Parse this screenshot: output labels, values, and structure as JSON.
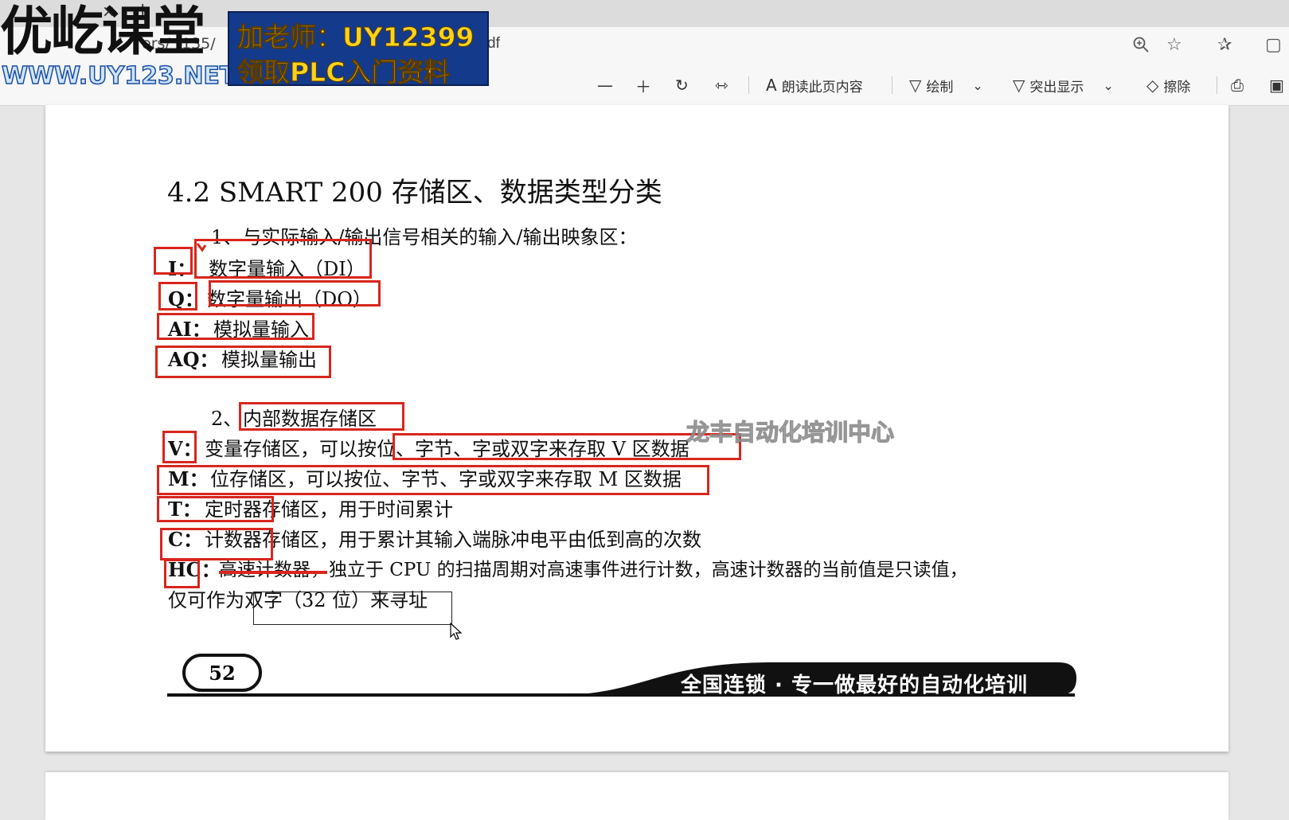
{
  "browser": {
    "address_partial": "df",
    "close_tab_glyph": "×",
    "new_tab_glyph": "+",
    "path_partial": "ers/",
    "path_partial2": "135/",
    "icons": [
      "zoom-icon",
      "favorite-star-icon",
      "favorites-list-icon"
    ]
  },
  "pdf_toolbar": {
    "read_aloud": "朗读此页内容",
    "draw": "绘制",
    "highlight": "突出显示",
    "erase": "擦除"
  },
  "logo": {
    "main": "优屹课堂",
    "url": "WWW.UY123.NET",
    "banner_line1": "加老师：UY12399",
    "banner_line2": "领取PLC入门资料"
  },
  "document": {
    "heading": "4.2 SMART 200 存储区、数据类型分类",
    "sub1": "1、与实际输入/输出信号相关的输入/输出映象区：",
    "items1": [
      {
        "code": "I：",
        "desc": "数字量输入（DI）"
      },
      {
        "code": "Q：",
        "desc": "数字量输出（DO）"
      },
      {
        "code": "AI：",
        "desc": "模拟量输入"
      },
      {
        "code": "AQ：",
        "desc": "模拟量输出"
      }
    ],
    "sub2_prefix": "2、",
    "sub2_text": "内部数据存储区",
    "items2": [
      {
        "code": "V：",
        "desc": "变量存储区，可以按位、字节、字或双字来存取 V 区数据"
      },
      {
        "code": "M：",
        "desc": "位存储区，可以按位、字节、字或双字来存取 M 区数据"
      },
      {
        "code": "T：",
        "desc": "定时器存储区，用于时间累计"
      },
      {
        "code": "C：",
        "desc": "计数器存储区，用于累计其输入端脉冲电平由低到高的次数"
      },
      {
        "code": "HC：",
        "desc": "高速计数器，独立于 CPU 的扫描周期对高速事件进行计数，高速计数器的当前值是只读值，"
      }
    ],
    "hc_line2": "仅可作为双字（32 位）来寻址",
    "page_number": "52",
    "slogan": "全国连锁 · 专一做最好的自动化培训"
  },
  "watermark": "龙丰自动化培训中心",
  "colors": {
    "annotation_red": "#d8261e",
    "banner_blue": "#143a8c",
    "banner_text": "#ffd21a"
  }
}
